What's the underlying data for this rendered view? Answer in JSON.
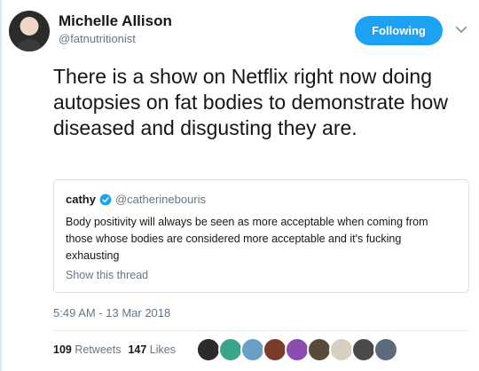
{
  "author": {
    "name": "Michelle Allison",
    "handle": "@fatnutritionist",
    "follow_label": "Following"
  },
  "tweet": {
    "text": "There is a show on Netflix right now doing autopsies on fat bodies to demonstrate how diseased and disgusting they are.",
    "timestamp": "5:49 AM - 13 Mar 2018",
    "retweets_count": "109",
    "retweets_label": "Retweets",
    "likes_count": "147",
    "likes_label": "Likes"
  },
  "quoted": {
    "name": "cathy",
    "handle": "@catherinebouris",
    "body": "Body positivity will always be seen as more acceptable when coming from those whose bodies are considered more acceptable and it's fucking exhausting",
    "show_thread": "Show this thread"
  },
  "colors": {
    "accent": "#1da1f2",
    "muted": "#657786",
    "text": "#14171a"
  },
  "liker_avatars": [
    {
      "color": "#2b2b2b"
    },
    {
      "color": "#3aa58a"
    },
    {
      "color": "#6aa0c8"
    },
    {
      "color": "#7b3b2b"
    },
    {
      "color": "#8b4bb0"
    },
    {
      "color": "#5a4a3a"
    },
    {
      "color": "#d7d0c0"
    },
    {
      "color": "#4a4a4a"
    },
    {
      "color": "#5b6b7b"
    }
  ]
}
